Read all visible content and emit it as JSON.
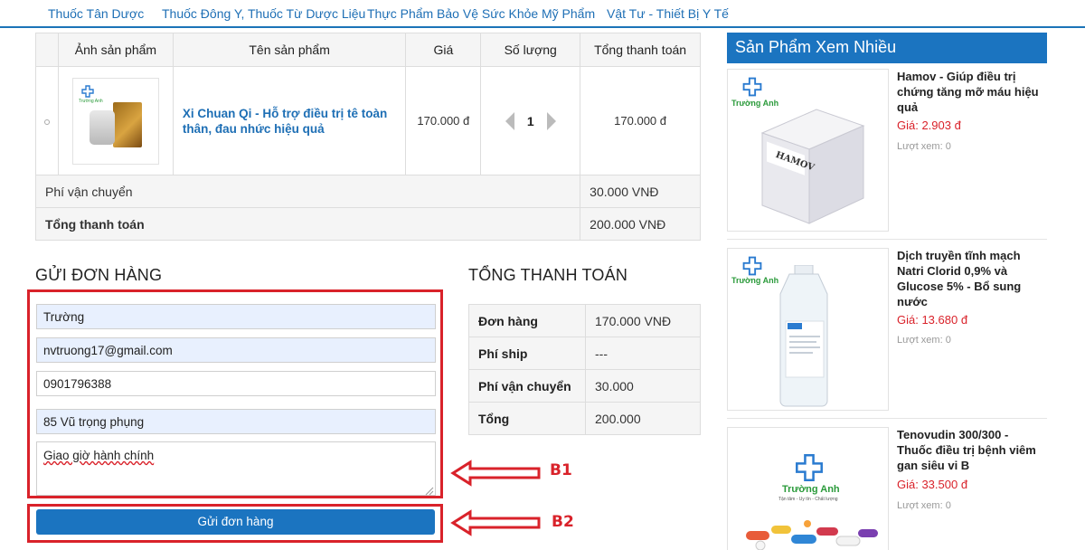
{
  "nav": {
    "items": [
      "Thuốc Tân Dược",
      "Thuốc Đông Y, Thuốc Từ Dược Liệu",
      "Thực Phẩm Bảo Vệ Sức Khỏe",
      "Mỹ Phẩm",
      "Vật Tư - Thiết Bị Y Tế"
    ]
  },
  "cart": {
    "headers": [
      "Ảnh sản phẩm",
      "Tên sản phẩm",
      "Giá",
      "Số lượng",
      "Tổng thanh toán"
    ],
    "product": {
      "thumb_brand": "Trường Anh",
      "name": "Xi Chuan Qi - Hỗ trợ điều trị tê toàn thân, đau nhức hiệu quả",
      "price": "170.000 đ",
      "quantity": "1",
      "total": "170.000 đ"
    },
    "shipping_label": "Phí vận chuyển",
    "shipping_value": "30.000 VNĐ",
    "grand_label": "Tổng thanh toán",
    "grand_value": "200.000 VNĐ"
  },
  "order_form": {
    "title": "GỬI ĐƠN HÀNG",
    "name_value": "Trường",
    "email_value": "nvtruong17@gmail.com",
    "phone_value": "0901796388",
    "address_value": "85 Vũ trọng phụng",
    "note_value": "Giao giờ hành chính",
    "submit_label": "Gửi đơn hàng"
  },
  "annotations": {
    "b1": "B1",
    "b2": "B2",
    "accent_color": "#d9222a"
  },
  "totals": {
    "title": "TỔNG THANH TOÁN",
    "rows": [
      {
        "label": "Đơn hàng",
        "value": "170.000 VNĐ"
      },
      {
        "label": "Phí ship",
        "value": "---"
      },
      {
        "label": "Phí vận chuyển",
        "value": "30.000"
      },
      {
        "label": "Tổng",
        "value": "200.000"
      }
    ]
  },
  "sidebar": {
    "title": "Sản Phẩm Xem Nhiều",
    "items": [
      {
        "title": "Hamov - Giúp điều trị chứng tăng mỡ máu hiệu quả",
        "price": "Giá: 2.903 đ",
        "views": "Lượt xem: 0",
        "brand": "Trường Anh",
        "box_label": "HAMOV"
      },
      {
        "title": "Dịch truyền tĩnh mạch Natri Clorid 0,9% và Glucose 5% - Bổ sung nước",
        "price": "Giá: 13.680 đ",
        "views": "Lượt xem: 0",
        "brand": "Trường Anh"
      },
      {
        "title": "Tenovudin 300/300 - Thuốc điều trị bệnh viêm gan siêu vi B",
        "price": "Giá: 33.500 đ",
        "views": "Lượt xem: 0",
        "brand": "Trường Anh",
        "tagline": "Tận tâm - Uy tín - Chất lượng"
      }
    ]
  },
  "colors": {
    "primary": "#1b74c0",
    "link": "#1e6fb5",
    "price_red": "#d9222a"
  }
}
